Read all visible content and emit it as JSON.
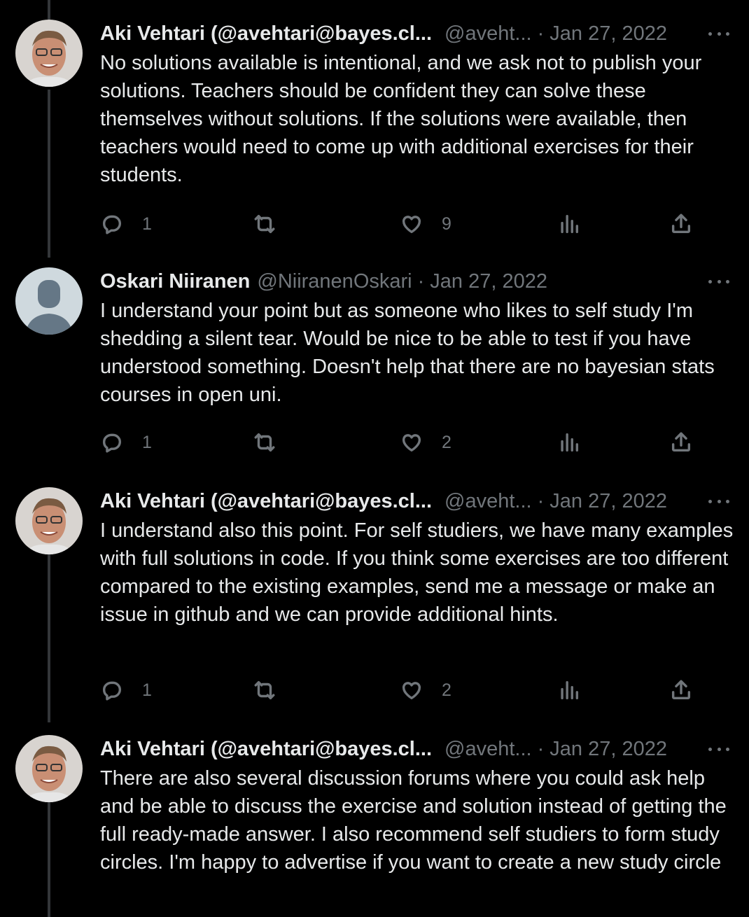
{
  "tweets": [
    {
      "name": "Aki Vehtari (@avehtari@bayes.cl...",
      "handle": "@aveht...",
      "date": "Jan 27, 2022",
      "text": "No solutions available is intentional, and we ask not to publish your solutions. Teachers should be confident they can solve these themselves without solutions. If the solutions were available, then teachers would need to come up with additional exercises for their students.",
      "replies": "1",
      "likes": "9"
    },
    {
      "name": "Oskari Niiranen",
      "handle": "@NiiranenOskari",
      "date": "Jan 27, 2022",
      "text": "I understand your point but as someone who likes to self study I'm shedding a silent tear. Would be nice to be able to test if you have understood something. Doesn't help that there are no bayesian stats courses in open uni.",
      "replies": "1",
      "likes": "2"
    },
    {
      "name": "Aki Vehtari (@avehtari@bayes.cl...",
      "handle": "@aveht...",
      "date": "Jan 27, 2022",
      "text": "I understand also this point. For self studiers, we have many examples with full solutions in code. If you think some exercises are too different compared to the existing examples, send me a message or make an issue in github and we can provide additional hints.",
      "replies": "1",
      "likes": "2"
    },
    {
      "name": "Aki Vehtari (@avehtari@bayes.cl...",
      "handle": "@aveht...",
      "date": "Jan 27, 2022",
      "text": "There are also several discussion forums where you could ask help and be able to discuss the exercise and solution instead of getting the full ready-made answer. I also recommend self studiers to form study circles. I'm happy to advertise if you want to create a new study circle"
    }
  ],
  "separator": "·",
  "colors": {
    "background": "#000000",
    "text": "#e7e9ea",
    "secondary": "#71767b",
    "thread_line": "#333639"
  }
}
